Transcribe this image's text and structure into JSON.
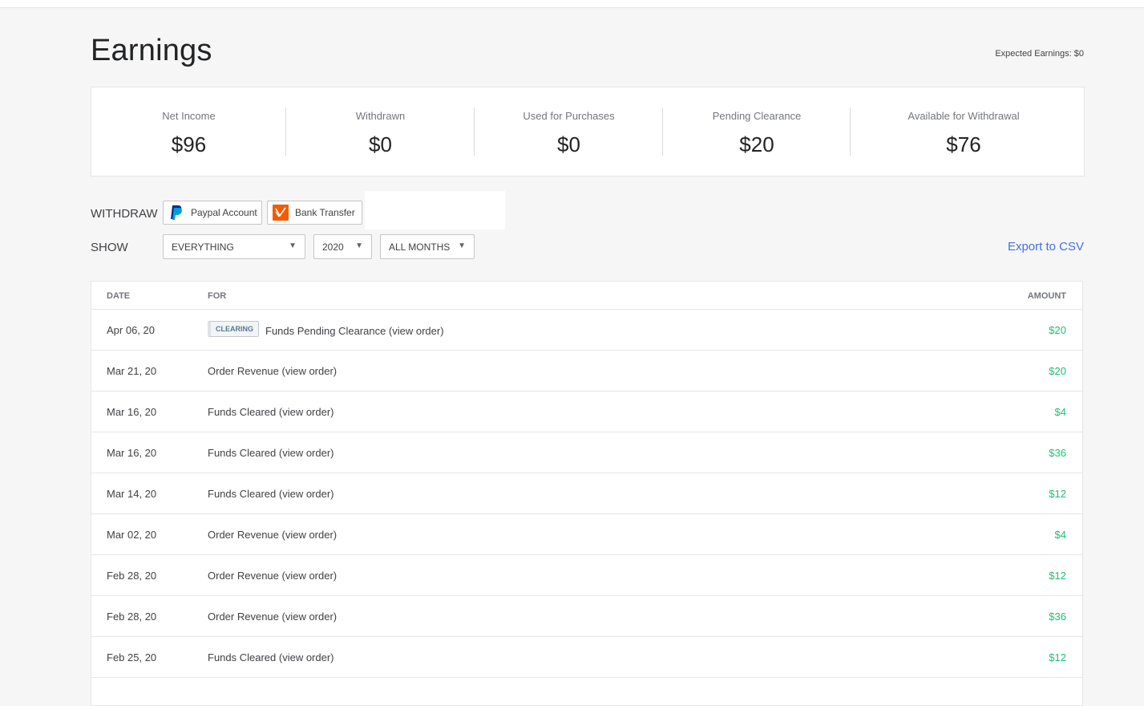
{
  "page": {
    "title": "Earnings",
    "expected": "Expected Earnings: $0"
  },
  "stats": [
    {
      "label": "Net Income",
      "value": "$96"
    },
    {
      "label": "Withdrawn",
      "value": "$0"
    },
    {
      "label": "Used for Purchases",
      "value": "$0"
    },
    {
      "label": "Pending Clearance",
      "value": "$20"
    },
    {
      "label": "Available for Withdrawal",
      "value": "$76"
    }
  ],
  "withdraw": {
    "label": "WITHDRAW",
    "paypal_label": "Paypal Account",
    "bank_label": "Bank Transfer",
    "paypal_icon": "paypal-icon",
    "bank_icon": "bank-transfer-icon"
  },
  "filters": {
    "label": "SHOW",
    "type_value": "EVERYTHING",
    "year_value": "2020",
    "month_value": "ALL MONTHS",
    "export_label": "Export to CSV"
  },
  "table": {
    "headers": {
      "date": "DATE",
      "for": "FOR",
      "amount": "AMOUNT"
    },
    "rows": [
      {
        "date": "Apr 06, 20",
        "badge": "CLEARING",
        "desc": "Funds Pending Clearance (view order)",
        "amount": "$20"
      },
      {
        "date": "Mar 21, 20",
        "badge": "",
        "desc": "Order Revenue (view order)",
        "amount": "$20"
      },
      {
        "date": "Mar 16, 20",
        "badge": "",
        "desc": "Funds Cleared (view order)",
        "amount": "$4"
      },
      {
        "date": "Mar 16, 20",
        "badge": "",
        "desc": "Funds Cleared (view order)",
        "amount": "$36"
      },
      {
        "date": "Mar 14, 20",
        "badge": "",
        "desc": "Funds Cleared (view order)",
        "amount": "$12"
      },
      {
        "date": "Mar 02, 20",
        "badge": "",
        "desc": "Order Revenue (view order)",
        "amount": "$4"
      },
      {
        "date": "Feb 28, 20",
        "badge": "",
        "desc": "Order Revenue (view order)",
        "amount": "$12"
      },
      {
        "date": "Feb 28, 20",
        "badge": "",
        "desc": "Order Revenue (view order)",
        "amount": "$36"
      },
      {
        "date": "Feb 25, 20",
        "badge": "",
        "desc": "Funds Cleared (view order)",
        "amount": "$12"
      }
    ]
  },
  "colors": {
    "accent": "#446ee7",
    "amount": "#1dbf73",
    "bank": "#f25c05",
    "paypal": "#003087"
  }
}
